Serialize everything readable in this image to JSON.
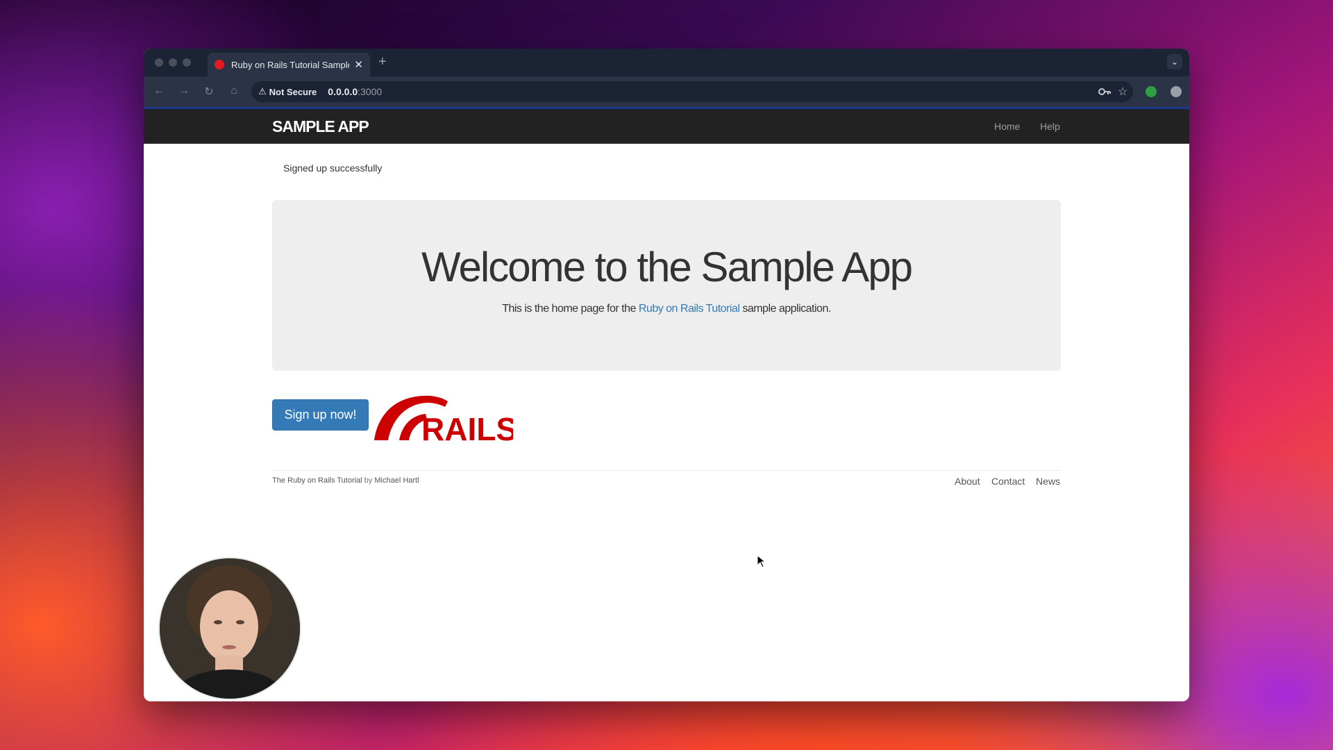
{
  "browser": {
    "tab_title": "Ruby on Rails Tutorial Sample",
    "tab_close": "✕",
    "new_tab": "+",
    "security_label": "Not Secure",
    "url_host": "0.0.0.0",
    "url_port": ":3000"
  },
  "navbar": {
    "brand": "SAMPLE APP",
    "links": [
      "Home",
      "Help"
    ]
  },
  "flash": "Signed up successfully",
  "hero": {
    "title": "Welcome to the Sample App",
    "lead_before": "This is the home page for the ",
    "lead_link": "Ruby on Rails Tutorial",
    "lead_after": " sample application."
  },
  "signup_button": "Sign up now!",
  "rails_logo_text": "RAILS",
  "footer": {
    "credit_link": "The Ruby on Rails Tutorial",
    "credit_by": " by ",
    "credit_author": "Michael Hartl",
    "links": [
      "About",
      "Contact",
      "News"
    ]
  },
  "colors": {
    "navbar": "#222222",
    "jumbotron": "#eeeeee",
    "primary": "#337ab7",
    "rails_red": "#cc0000"
  },
  "icons": [
    "back-arrow-icon",
    "forward-arrow-icon",
    "reload-icon",
    "home-icon",
    "warning-icon",
    "key-icon",
    "star-icon",
    "extensions-icon",
    "menu-icon"
  ]
}
